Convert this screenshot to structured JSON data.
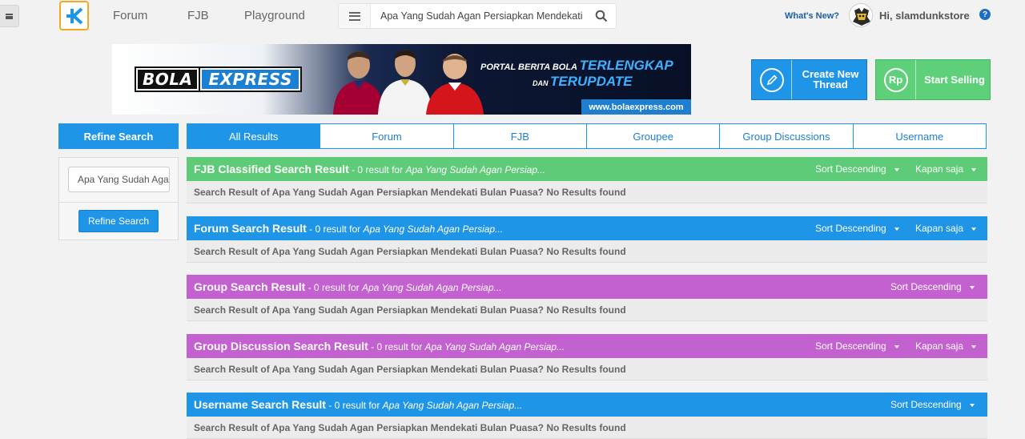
{
  "nav": {
    "links": [
      "Forum",
      "FJB",
      "Playground"
    ],
    "search_query": "Apa Yang Sudah Agan Persiapkan Mendekati Bulan Puasa?",
    "whats_new": "What's New?",
    "user_greeting": "Hi, slamdunkstore",
    "help": "?"
  },
  "banner": {
    "brand_bola": "BOLA",
    "brand_express": "EXPRESS",
    "tagline_line1": "PORTAL BERITA BOLA",
    "tagline_highlight1": "TERLENGKAP",
    "tagline_line2": "DAN",
    "tagline_highlight2": "TERUPDATE",
    "url": "www.bolaexpress.com"
  },
  "actions": {
    "create_thread": "Create New Thread",
    "start_selling": "Start Selling",
    "rp_symbol": "Rp"
  },
  "refine": {
    "title": "Refine Search",
    "input_value": "Apa Yang Sudah Agan Persiapkan Mendekati Bulan Puasa?",
    "button": "Refine Search"
  },
  "tabs": [
    "All Results",
    "Forum",
    "FJB",
    "Groupee",
    "Group Discussions",
    "Username"
  ],
  "sections": [
    {
      "title": "FJB Classified Search Result",
      "sub_prefix": " - 0 result for ",
      "sub_query": "Apa Yang Sudah Agan Persiap...",
      "sort": "Sort Descending",
      "time": "Kapan saja",
      "message": "Search Result of Apa Yang Sudah Agan Persiapkan Mendekati Bulan Puasa? No Results found",
      "color": "#5ecb78"
    },
    {
      "title": "Forum Search Result",
      "sub_prefix": " - 0 result for ",
      "sub_query": "Apa Yang Sudah Agan Persiap...",
      "sort": "Sort Descending",
      "time": "Kapan saja",
      "message": "Search Result of Apa Yang Sudah Agan Persiapkan Mendekati Bulan Puasa? No Results found",
      "color": "#1f95e8"
    },
    {
      "title": "Group Search Result",
      "sub_prefix": " - 0 result for ",
      "sub_query": "Apa Yang Sudah Agan Persiap...",
      "sort": "Sort Descending",
      "message": "Search Result of Apa Yang Sudah Agan Persiapkan Mendekati Bulan Puasa? No Results found",
      "color": "#c461d0"
    },
    {
      "title": "Group Discussion Search Result",
      "sub_prefix": " - 0 result for ",
      "sub_query": "Apa Yang Sudah Agan Persiap...",
      "sort": "Sort Descending",
      "time": "Kapan saja",
      "message": "Search Result of Apa Yang Sudah Agan Persiapkan Mendekati Bulan Puasa? No Results found",
      "color": "#c461d0"
    },
    {
      "title": "Username Search Result",
      "sub_prefix": " - 0 result for ",
      "sub_query": "Apa Yang Sudah Agan Persiap...",
      "sort": "Sort Descending",
      "message": "Search Result of Apa Yang Sudah Agan Persiapkan Mendekati Bulan Puasa? No Results found",
      "color": "#1f95e8"
    }
  ]
}
